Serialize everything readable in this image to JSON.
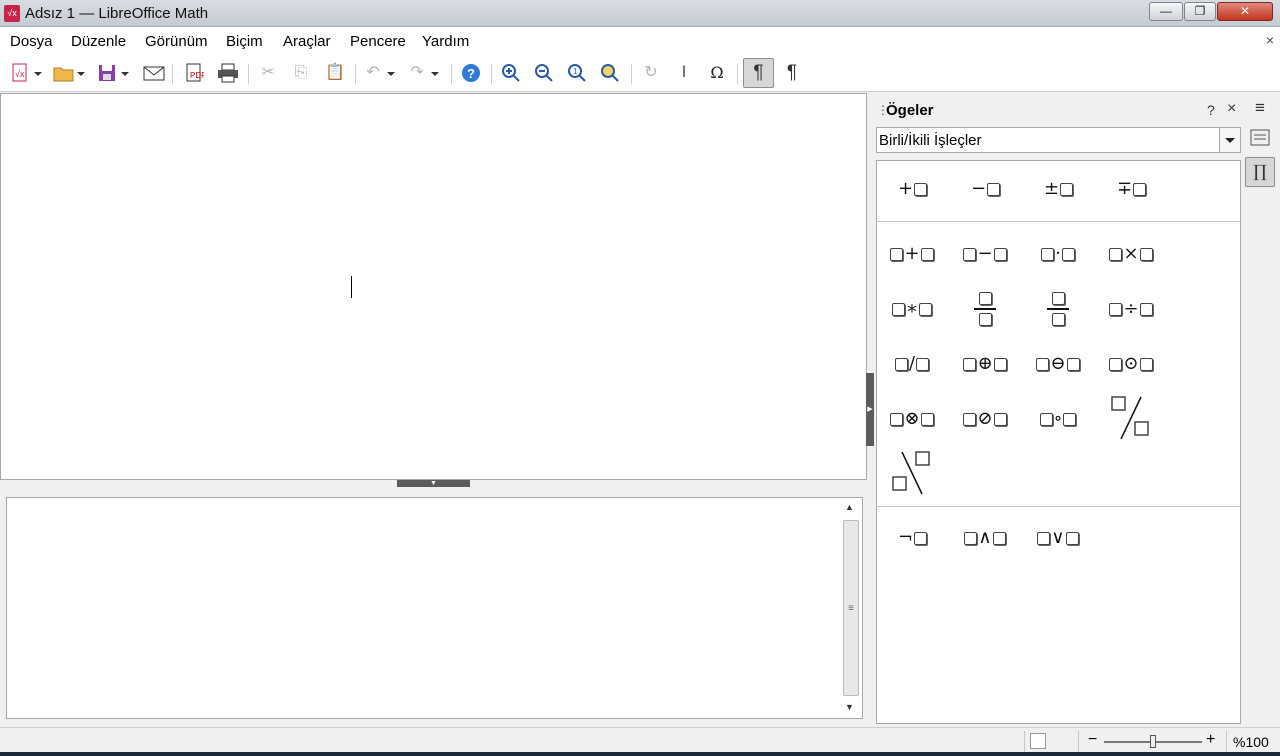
{
  "window": {
    "title": "Adsız 1 — LibreOffice Math",
    "app_icon": "libreoffice-math-icon",
    "buttons": {
      "minimize": "—",
      "maximize": "❐",
      "close": "✕"
    }
  },
  "menubar": {
    "items": [
      "Dosya",
      "Düzenle",
      "Görünüm",
      "Biçim",
      "Araçlar",
      "Pencere",
      "Yardım"
    ],
    "doc_close": "×"
  },
  "toolbar": {
    "items": [
      "new",
      "open",
      "save",
      "email",
      "export-pdf",
      "print",
      "cut",
      "copy",
      "paste",
      "undo",
      "redo",
      "help",
      "zoom-in",
      "zoom-out",
      "zoom-100",
      "zoom-show-all",
      "update",
      "formula-cursor",
      "symbols",
      "show-elements",
      "show-formatting"
    ]
  },
  "sidebar": {
    "title": "Ögeler",
    "help": "?",
    "close": "×",
    "menu": "≡",
    "category": "Birli/İkili İşleçler",
    "groups": [
      {
        "items": [
          {
            "name": "unary-plus",
            "op": "+",
            "left": false
          },
          {
            "name": "unary-minus",
            "op": "−",
            "left": false
          },
          {
            "name": "plus-minus",
            "op": "±",
            "left": false
          },
          {
            "name": "minus-plus",
            "op": "∓",
            "left": false
          }
        ]
      },
      {
        "items": [
          {
            "name": "addition",
            "op": "+",
            "left": true
          },
          {
            "name": "subtraction",
            "op": "−",
            "left": true
          },
          {
            "name": "multiplication-dot",
            "op": "·",
            "left": true
          },
          {
            "name": "multiplication-x",
            "op": "×",
            "left": true
          },
          {
            "name": "multiplication-asterisk",
            "op": "∗",
            "left": true
          },
          {
            "name": "fraction",
            "frac": true
          },
          {
            "name": "fraction-wide",
            "frac": true
          },
          {
            "name": "division",
            "op": "÷",
            "left": true
          },
          {
            "name": "slash",
            "op": "/",
            "left": true
          },
          {
            "name": "circled-plus",
            "op": "⊕",
            "left": true
          },
          {
            "name": "circled-minus",
            "op": "⊖",
            "left": true
          },
          {
            "name": "circled-dot",
            "op": "⊙",
            "left": true
          },
          {
            "name": "circled-times",
            "op": "⊗",
            "left": true
          },
          {
            "name": "circled-slash",
            "op": "⊘",
            "left": true
          },
          {
            "name": "concatenate",
            "op": "∘",
            "left": true
          },
          {
            "name": "wideslash",
            "slash": "forward"
          },
          {
            "name": "widebslash",
            "slash": "back"
          }
        ]
      },
      {
        "items": [
          {
            "name": "boolean-not",
            "op": "¬",
            "left": false
          },
          {
            "name": "boolean-and",
            "op": "∧",
            "left": true
          },
          {
            "name": "boolean-or",
            "op": "∨",
            "left": true
          }
        ]
      }
    ]
  },
  "tabbar": {
    "properties_icon": "properties-icon",
    "elements_glyph": "∏"
  },
  "statusbar": {
    "zoom": "%100",
    "zoom_minus": "−",
    "zoom_plus": "+",
    "zoom_level": 1.0
  }
}
